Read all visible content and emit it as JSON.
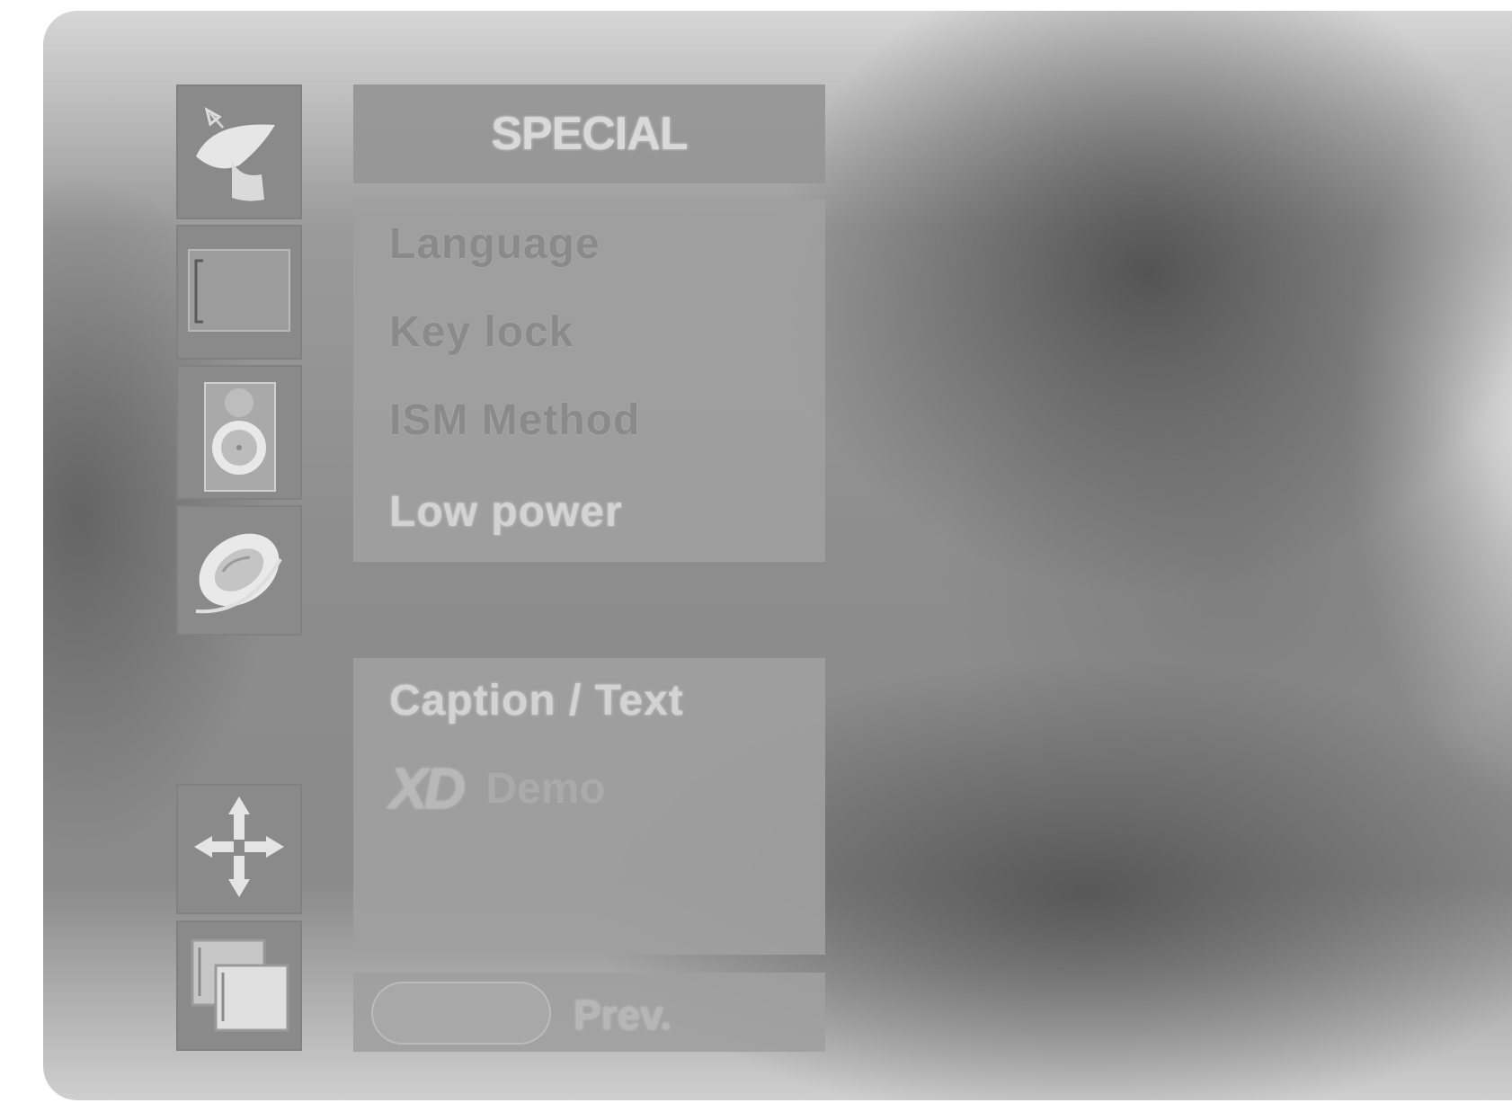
{
  "menu_title": "SPECIAL",
  "tabs": [
    "satellite-dish-icon",
    "screen-icon",
    "speaker-icon",
    "disc-icon",
    "move-arrows-icon",
    "pip-windows-icon"
  ],
  "items": [
    "Language",
    "Key lock",
    "ISM Method",
    "Low power"
  ],
  "sub_items": {
    "caption_text": "Caption / Text",
    "xd_logo": "XD",
    "xd_demo": "Demo"
  },
  "footer": {
    "prev_label": "Prev."
  },
  "colors": {
    "panel": "#a0a0a0",
    "title_text": "#d9d9d9",
    "background": "#8d8d8d"
  }
}
